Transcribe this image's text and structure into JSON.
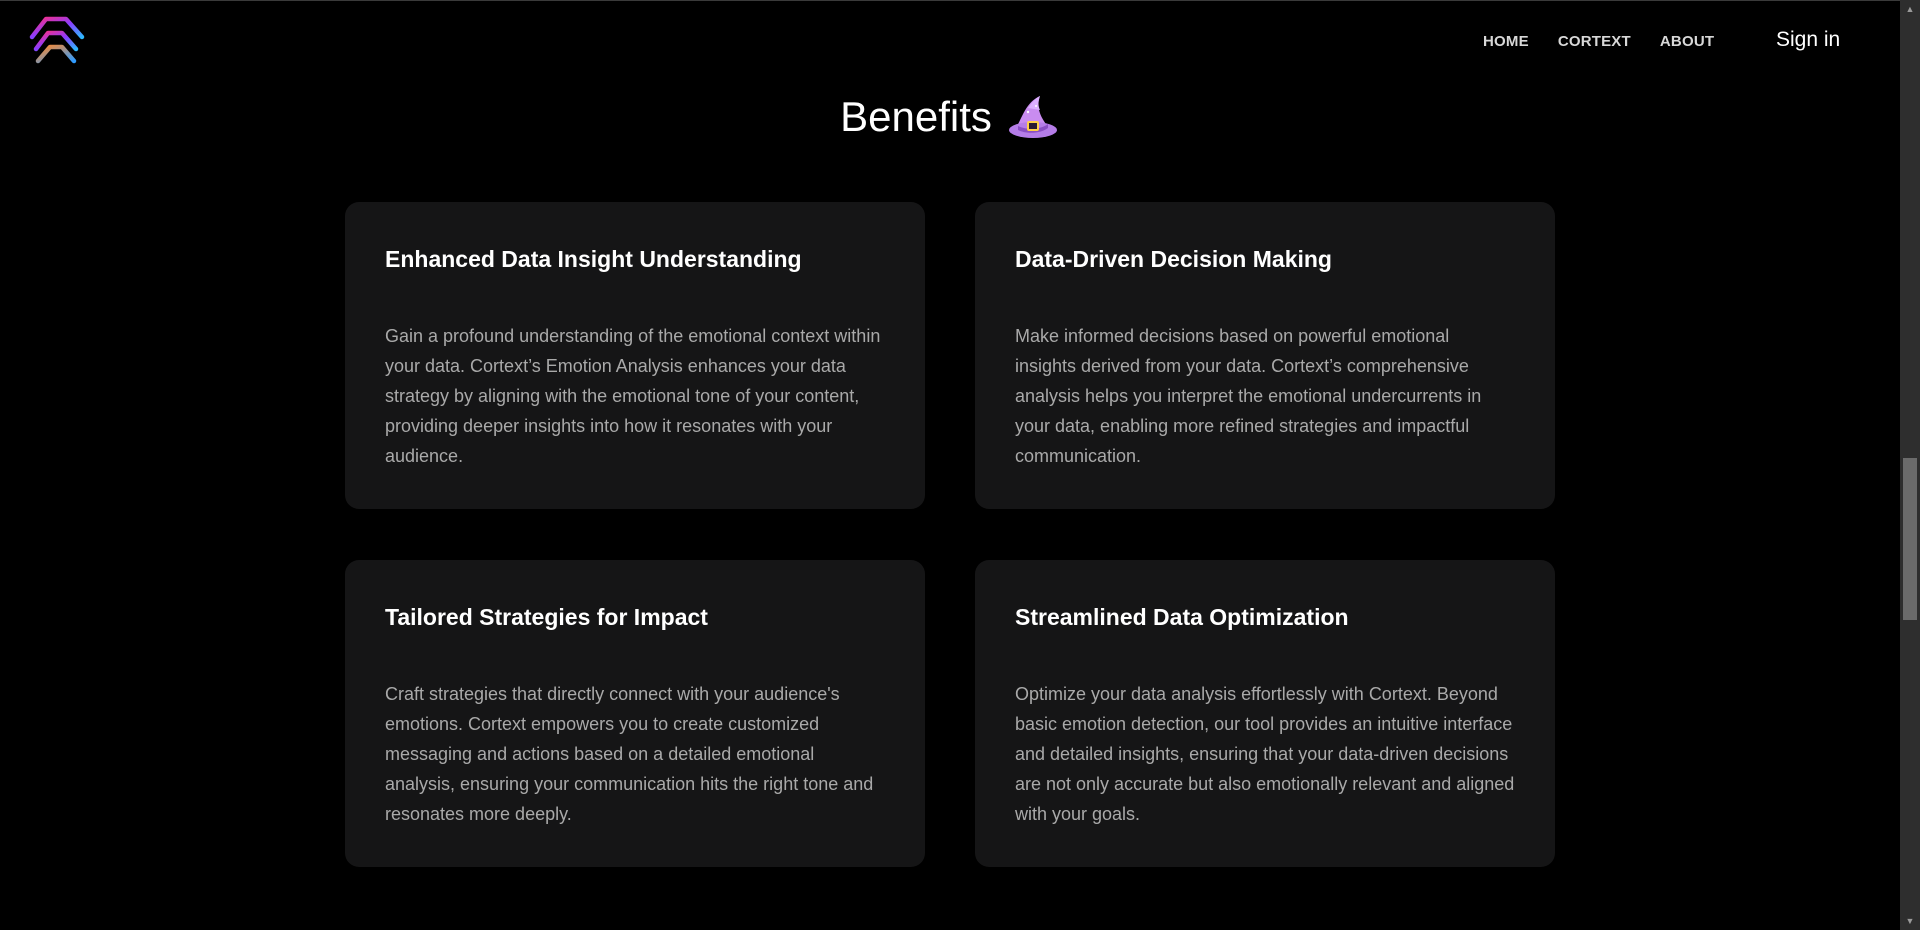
{
  "nav": {
    "items": [
      "HOME",
      "CORTEXT",
      "ABOUT"
    ],
    "sign_in": "Sign in"
  },
  "section": {
    "title": "Benefits",
    "title_icon": "witch-hat-icon"
  },
  "cards": [
    {
      "title": "Enhanced Data Insight Understanding",
      "body": "Gain a profound understanding of the emotional context within your data. Cortext’s Emotion Analysis enhances your data strategy by aligning with the emotional tone of your content, providing deeper insights into how it resonates with your audience."
    },
    {
      "title": "Data-Driven Decision Making",
      "body": "Make informed decisions based on powerful emotional insights derived from your data. Cortext’s comprehensive analysis helps you interpret the emotional undercurrents in your data, enabling more refined strategies and impactful communication."
    },
    {
      "title": "Tailored Strategies for Impact",
      "body": "Craft strategies that directly connect with your audience's emotions. Cortext empowers you to create customized messaging and actions based on a detailed emotional analysis, ensuring your communication hits the right tone and resonates more deeply."
    },
    {
      "title": "Streamlined Data Optimization",
      "body": "Optimize your data analysis effortlessly with Cortext. Beyond basic emotion detection, our tool provides an intuitive interface and detailed insights, ensuring that your data-driven decisions are not only accurate but also emotionally relevant and aligned with your goals."
    }
  ],
  "colors": {
    "background": "#000000",
    "card": "#151516",
    "body_text": "#a9a9a9"
  }
}
